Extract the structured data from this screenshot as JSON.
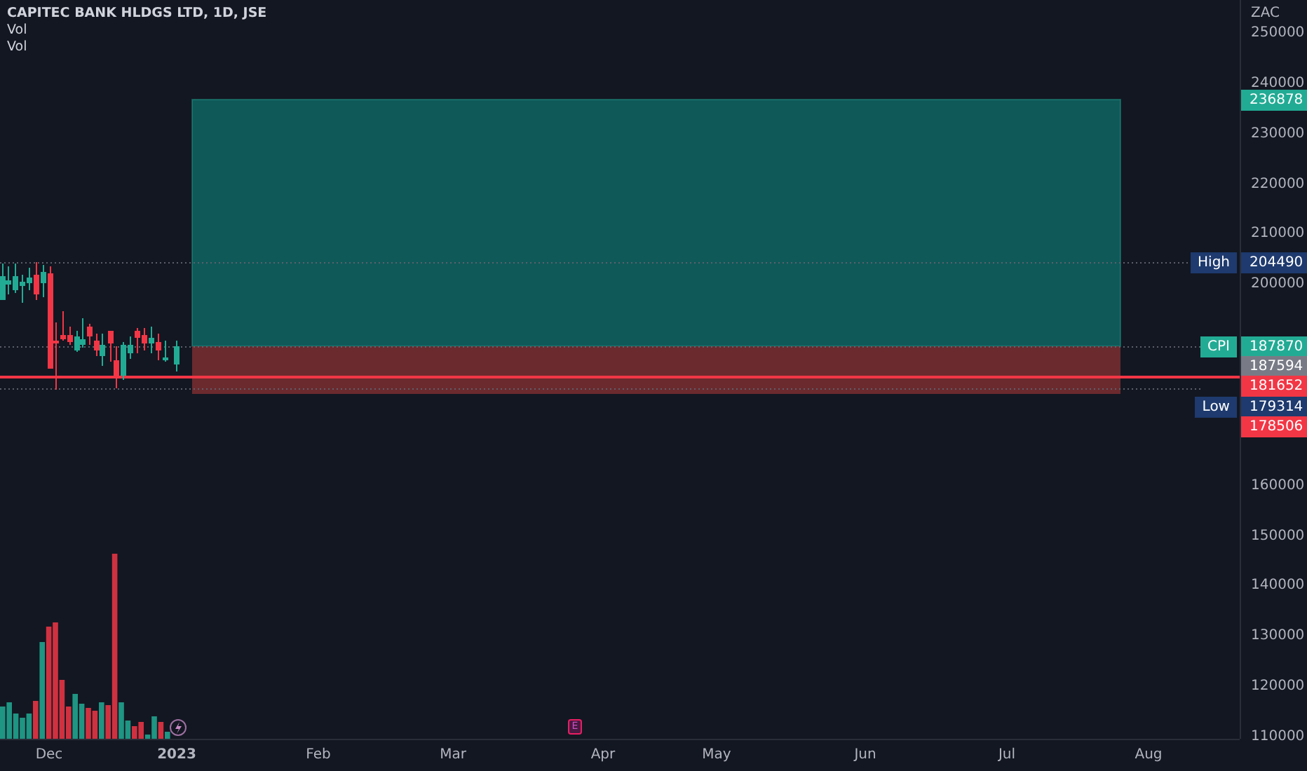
{
  "legend": {
    "title": "CAPITEC BANK HLDGS LTD, 1D, JSE",
    "indicators": [
      "Vol",
      "Vol"
    ]
  },
  "price_axis": {
    "currency": "ZAC",
    "ticks": [
      "250000",
      "240000",
      "230000",
      "220000",
      "210000",
      "200000",
      "160000",
      "150000",
      "140000",
      "130000",
      "120000",
      "110000"
    ]
  },
  "markers": [
    {
      "value": "236878",
      "color": "#22ab94"
    },
    {
      "value": "204490",
      "label": "High",
      "color": "#1e3a6e"
    },
    {
      "value": "187870",
      "label": "CPI",
      "color": "#22ab94"
    },
    {
      "value": "187594",
      "color": "#787b86"
    },
    {
      "value": "181652",
      "color": "#f23645"
    },
    {
      "value": "179314",
      "label": "Low",
      "color": "#1e3a6e"
    },
    {
      "value": "178506",
      "color": "#f23645"
    }
  ],
  "time_axis": [
    {
      "label": "Dec",
      "bold": false
    },
    {
      "label": "2023",
      "bold": true
    },
    {
      "label": "Feb",
      "bold": false
    },
    {
      "label": "Mar",
      "bold": false
    },
    {
      "label": "Apr",
      "bold": false
    },
    {
      "label": "May",
      "bold": false
    },
    {
      "label": "Jun",
      "bold": false
    },
    {
      "label": "Jul",
      "bold": false
    },
    {
      "label": "Aug",
      "bold": false
    }
  ],
  "events": [
    {
      "kind": "dividend"
    },
    {
      "kind": "earnings",
      "label": "E"
    }
  ]
}
